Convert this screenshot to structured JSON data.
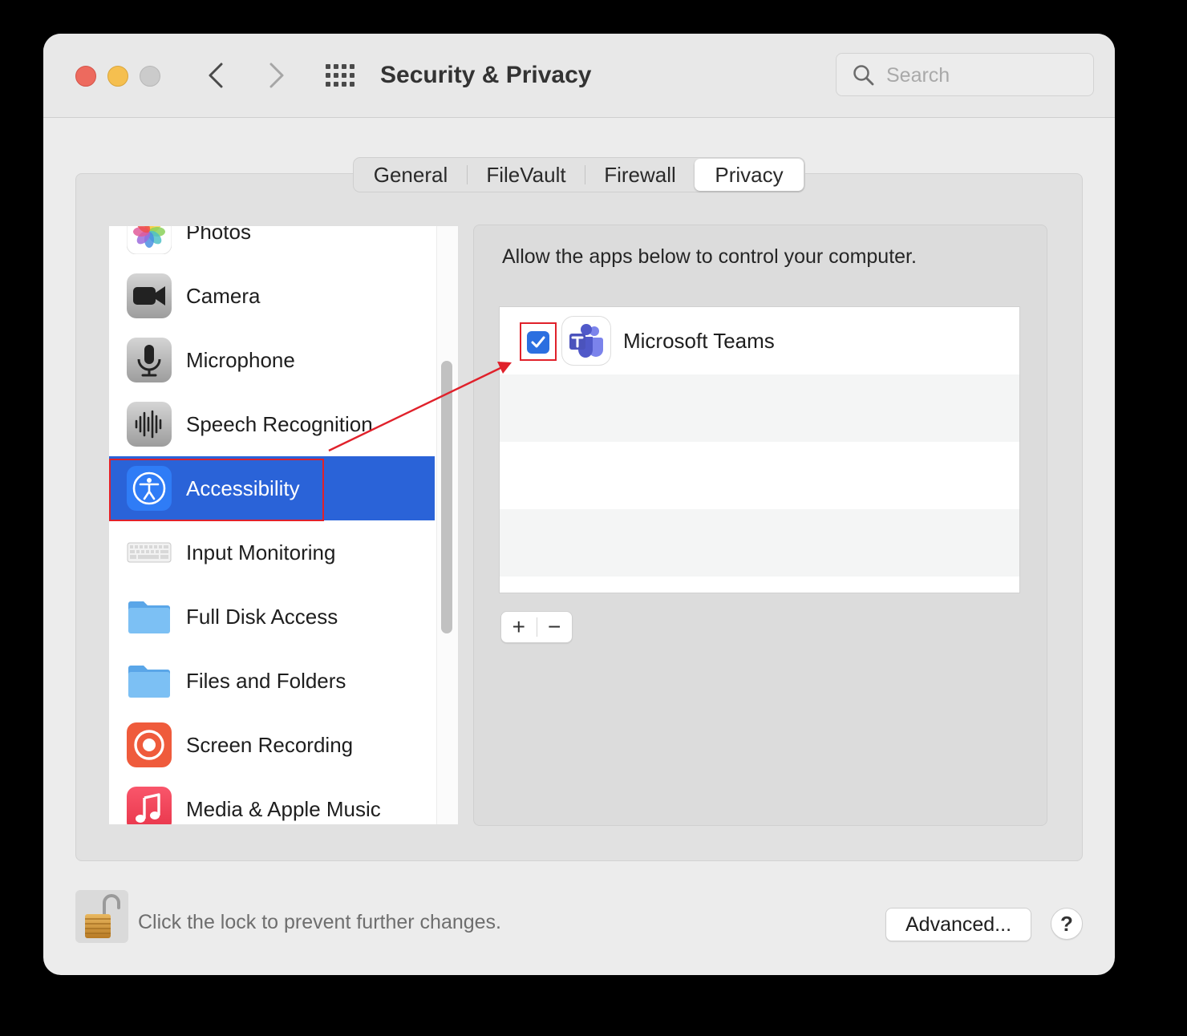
{
  "window": {
    "title": "Security & Privacy"
  },
  "search": {
    "placeholder": "Search"
  },
  "tabs": [
    {
      "label": "General"
    },
    {
      "label": "FileVault"
    },
    {
      "label": "Firewall"
    },
    {
      "label": "Privacy",
      "active": true
    }
  ],
  "sidebar": {
    "items": [
      {
        "label": "Photos",
        "icon": "photos-icon"
      },
      {
        "label": "Camera",
        "icon": "camera-icon"
      },
      {
        "label": "Microphone",
        "icon": "microphone-icon"
      },
      {
        "label": "Speech Recognition",
        "icon": "speech-recognition-icon"
      },
      {
        "label": "Accessibility",
        "icon": "accessibility-icon",
        "selected": true
      },
      {
        "label": "Input Monitoring",
        "icon": "keyboard-icon"
      },
      {
        "label": "Full Disk Access",
        "icon": "folder-icon"
      },
      {
        "label": "Files and Folders",
        "icon": "folder-icon"
      },
      {
        "label": "Screen Recording",
        "icon": "screen-recording-icon"
      },
      {
        "label": "Media & Apple Music",
        "icon": "music-icon"
      }
    ]
  },
  "panel": {
    "description": "Allow the apps below to control your computer.",
    "apps": [
      {
        "name": "Microsoft Teams",
        "checked": true,
        "icon": "microsoft-teams-icon"
      }
    ],
    "add_label": "+",
    "remove_label": "−"
  },
  "footer": {
    "lock_text": "Click the lock to prevent further changes.",
    "advanced_label": "Advanced...",
    "help_label": "?"
  },
  "colors": {
    "selection": "#2a63d8",
    "checkbox": "#2b6fe0",
    "annotation": "#e0212b",
    "close": "#ed6a5e",
    "minimize": "#f5bf4f"
  }
}
